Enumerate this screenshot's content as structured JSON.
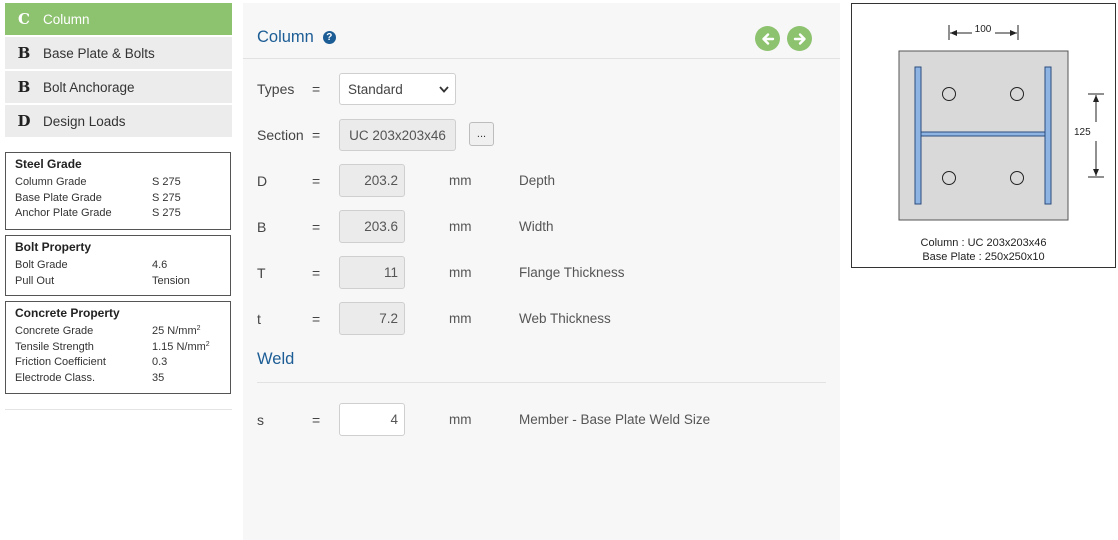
{
  "nav": [
    {
      "letter": "C",
      "label": "Column",
      "active": true
    },
    {
      "letter": "B",
      "label": "Base Plate & Bolts",
      "active": false
    },
    {
      "letter": "B",
      "label": "Bolt Anchorage",
      "active": false
    },
    {
      "letter": "D",
      "label": "Design Loads",
      "active": false
    }
  ],
  "steel_grade": {
    "title": "Steel Grade",
    "rows": [
      {
        "key": "Column Grade",
        "value": "S 275"
      },
      {
        "key": "Base Plate Grade",
        "value": "S 275"
      },
      {
        "key": "Anchor Plate Grade",
        "value": "S 275"
      }
    ]
  },
  "bolt_property": {
    "title": "Bolt Property",
    "rows": [
      {
        "key": "Bolt Grade",
        "value": "4.6"
      },
      {
        "key": "Pull Out",
        "value": "Tension"
      }
    ]
  },
  "concrete_property": {
    "title": "Concrete Property",
    "rows": [
      {
        "key": "Concrete Grade",
        "value": "25 N/mm",
        "sup": "2"
      },
      {
        "key": "Tensile Strength",
        "value": "1.15 N/mm",
        "sup": "2"
      },
      {
        "key": "Friction Coefficient",
        "value": "0.3"
      },
      {
        "key": "Electrode Class.",
        "value": "35"
      }
    ]
  },
  "main": {
    "title": "Column",
    "types": {
      "label": "Types",
      "eq": "=",
      "value": "Standard"
    },
    "section": {
      "label": "Section",
      "eq": "=",
      "value": "UC 203x203x46",
      "button": "..."
    },
    "fields": [
      {
        "label": "D",
        "eq": "=",
        "value": "203.2",
        "unit": "mm",
        "desc": "Depth"
      },
      {
        "label": "B",
        "eq": "=",
        "value": "203.6",
        "unit": "mm",
        "desc": "Width"
      },
      {
        "label": "T",
        "eq": "=",
        "value": "11",
        "unit": "mm",
        "desc": "Flange Thickness"
      },
      {
        "label": "t",
        "eq": "=",
        "value": "7.2",
        "unit": "mm",
        "desc": "Web Thickness"
      }
    ],
    "weld_title": "Weld",
    "weld": {
      "label": "s",
      "eq": "=",
      "value": "4",
      "unit": "mm",
      "desc": "Member - Base Plate Weld Size"
    }
  },
  "diagram": {
    "dim_top": "100",
    "dim_right": "125",
    "caption_column": "Column : UC 203x203x46",
    "caption_plate": "Base Plate : 250x250x10"
  },
  "colors": {
    "accent_green": "#8dc26f",
    "title_blue": "#1c5d95",
    "flange_blue": "#8eb4e3",
    "plate_grey": "#d9d9d9"
  }
}
